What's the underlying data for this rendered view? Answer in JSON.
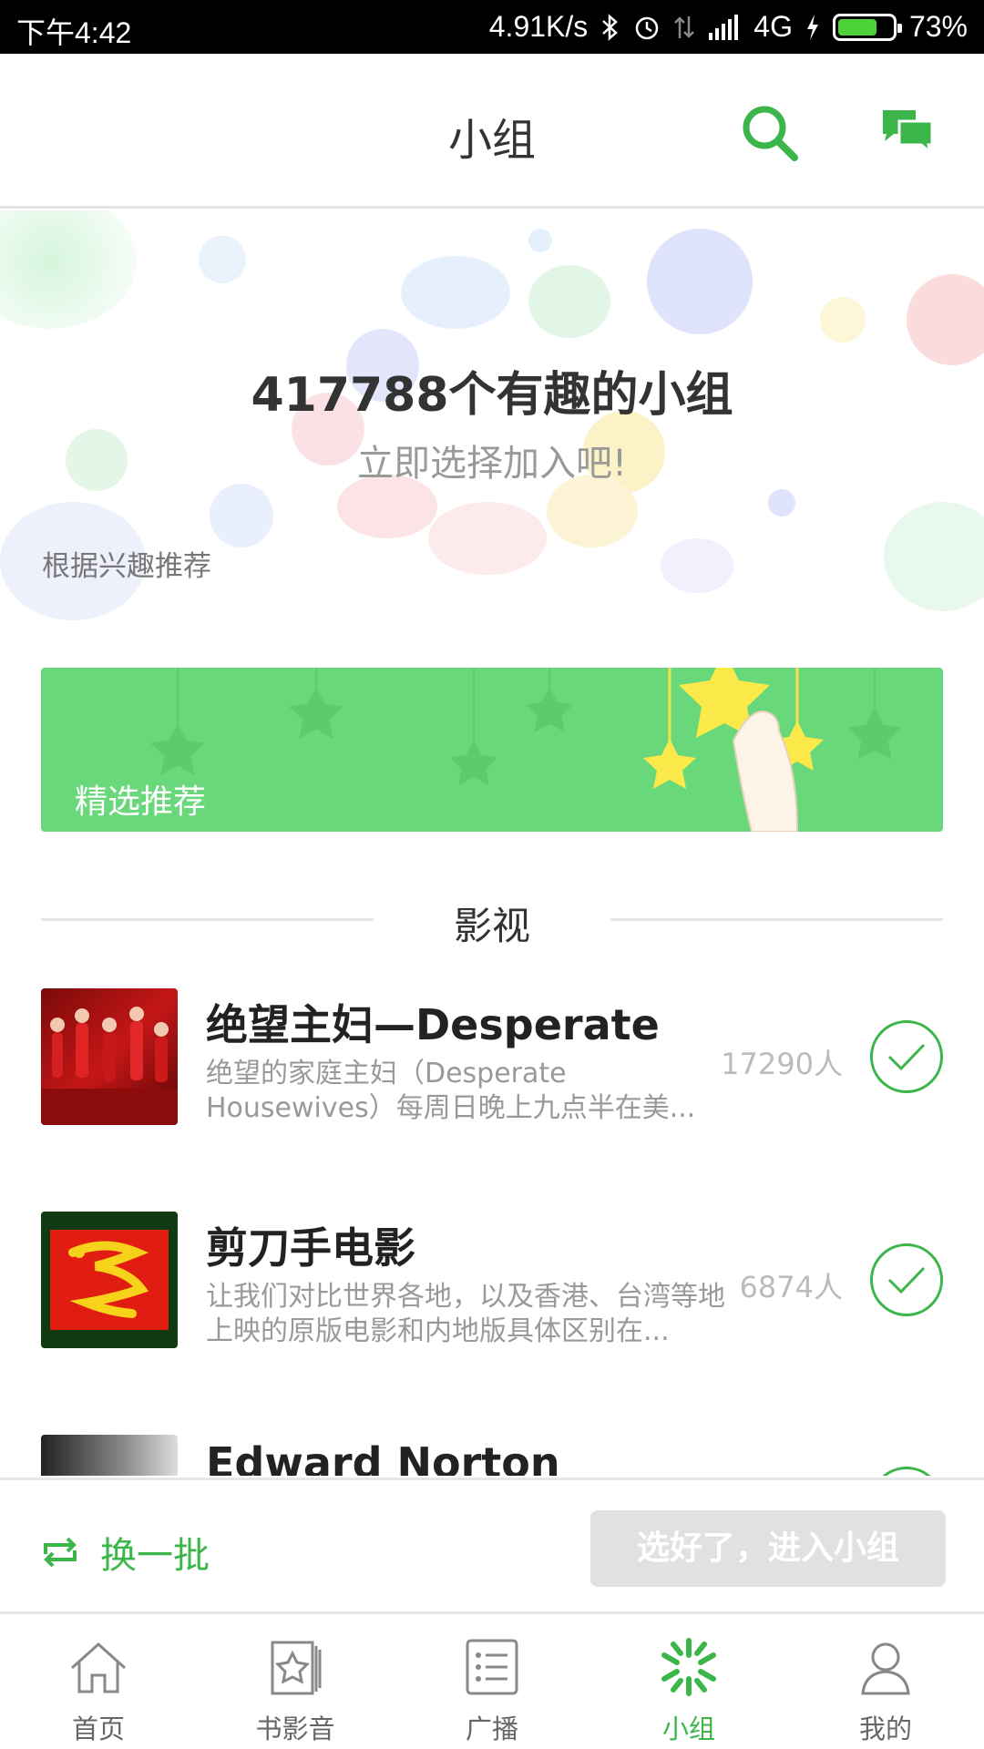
{
  "status_bar": {
    "time": "下午4:42",
    "speed": "4.91K/s",
    "network": "4G",
    "battery_percent": "73%",
    "battery_level": 0.73,
    "icons": [
      "bluetooth-icon",
      "alarm-icon",
      "data-transfer-icon",
      "signal-icon",
      "charging-icon",
      "battery-icon"
    ]
  },
  "header": {
    "title": "小组",
    "search_icon": "search-icon",
    "message_icon": "chat-bubbles-icon"
  },
  "hero": {
    "headline": "417788个有趣的小组",
    "subline": "立即选择加入吧!",
    "rec_label": "根据兴趣推荐"
  },
  "banner": {
    "label": "精选推荐"
  },
  "section": {
    "name": "影视"
  },
  "groups": [
    {
      "title": "绝望主妇—Desperate",
      "desc": "绝望的家庭主妇（Desperate Housewives）每周日晚上九点半在美...",
      "count": "17290人",
      "selected": true
    },
    {
      "title": "剪刀手电影",
      "desc": "让我们对比世界各地，以及香港、台湾等地上映的原版电影和内地版具体区别在...",
      "count": "6874人",
      "selected": true
    },
    {
      "title": "Edward Norton",
      "desc": "",
      "count": "",
      "selected": true
    }
  ],
  "action_bar": {
    "refresh_label": "换一批",
    "enter_label": "选好了，进入小组"
  },
  "bottom_nav": {
    "items": [
      {
        "label": "首页",
        "icon": "home-icon"
      },
      {
        "label": "书影音",
        "icon": "book-movie-music-icon"
      },
      {
        "label": "广播",
        "icon": "broadcast-icon"
      },
      {
        "label": "小组",
        "icon": "group-icon"
      },
      {
        "label": "我的",
        "icon": "profile-icon"
      }
    ],
    "active_index": 3
  },
  "colors": {
    "accent": "#3cb54a",
    "banner": "#68d87a",
    "disabled_button": "#e1e1e1"
  }
}
